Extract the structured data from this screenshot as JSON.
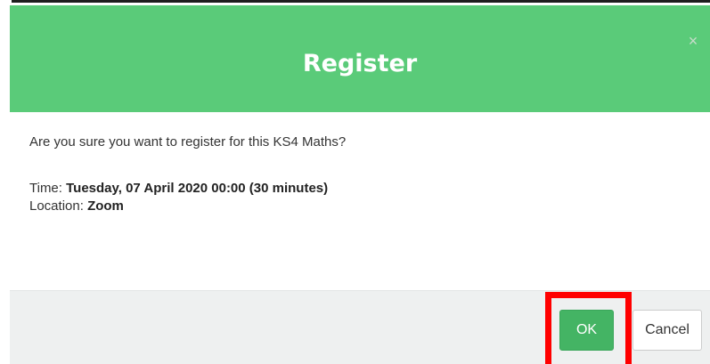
{
  "dialog": {
    "title": "Register",
    "close_symbol": "×",
    "question": "Are you sure you want to register for this KS4 Maths?",
    "time_label": "Time:",
    "time_value": "Tuesday, 07 April 2020 00:00 (30 minutes)",
    "location_label": "Location:",
    "location_value": "Zoom"
  },
  "footer": {
    "ok_label": "OK",
    "cancel_label": "Cancel"
  },
  "colors": {
    "header_green": "#5acb79",
    "ok_button_green": "#44b464",
    "highlight_red": "#ff0000",
    "footer_gray": "#eef0f0"
  },
  "icons": {
    "close": "close-icon"
  }
}
